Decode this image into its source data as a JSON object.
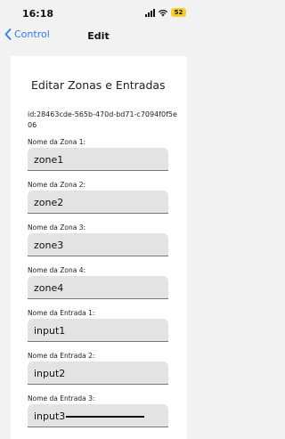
{
  "status": {
    "time": "16:18",
    "battery": "52"
  },
  "nav": {
    "back_label": "Control",
    "title": "Edit"
  },
  "form": {
    "title": "Editar Zonas e Entradas",
    "id_text": "id:28463cde-565b-470d-bd71-c7094f0f5e06",
    "fields": [
      {
        "label": "Nome da Zona 1:",
        "value": "zone1"
      },
      {
        "label": "Nome da Zona 2:",
        "value": "zone2"
      },
      {
        "label": "Nome da Zona 3:",
        "value": "zone3"
      },
      {
        "label": "Nome da Zona 4:",
        "value": "zone4"
      },
      {
        "label": "Nome da Entrada 1:",
        "value": "input1"
      },
      {
        "label": "Nome da Entrada 2:",
        "value": "input2"
      },
      {
        "label": "Nome da Entrada 3:",
        "value": "input3"
      }
    ]
  }
}
